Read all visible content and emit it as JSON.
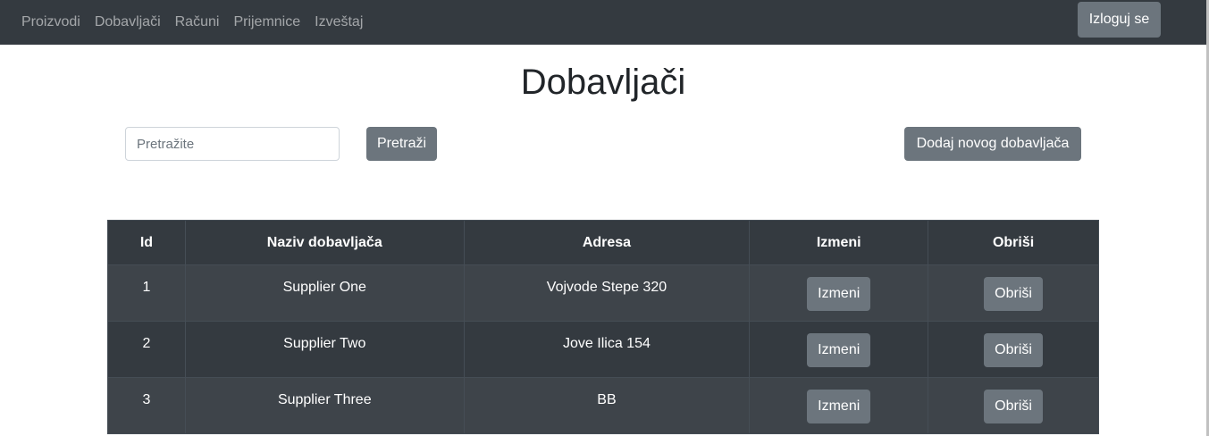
{
  "nav": {
    "links": [
      "Proizvodi",
      "Dobavljači",
      "Računi",
      "Prijemnice",
      "Izveštaj"
    ],
    "logout_label": "Izloguj se"
  },
  "page": {
    "title": "Dobavljači"
  },
  "search": {
    "placeholder": "Pretražite",
    "button_label": "Pretraži"
  },
  "add_button_label": "Dodaj novog dobavljača",
  "table": {
    "headers": [
      "Id",
      "Naziv dobavljača",
      "Adresa",
      "Izmeni",
      "Obriši"
    ],
    "rows": [
      {
        "id": "1",
        "name": "Supplier One",
        "address": "Vojvode Stepe 320",
        "edit_label": "Izmeni",
        "delete_label": "Obriši"
      },
      {
        "id": "2",
        "name": "Supplier Two",
        "address": "Jove Ilica 154",
        "edit_label": "Izmeni",
        "delete_label": "Obriši"
      },
      {
        "id": "3",
        "name": "Supplier Three",
        "address": "BB",
        "edit_label": "Izmeni",
        "delete_label": "Obriši"
      }
    ]
  },
  "colors": {
    "navbar": "#343a40",
    "button": "#6c757d",
    "table_header": "#343a40",
    "table_row_odd": "#3e444a",
    "table_row_even": "#343a40"
  }
}
